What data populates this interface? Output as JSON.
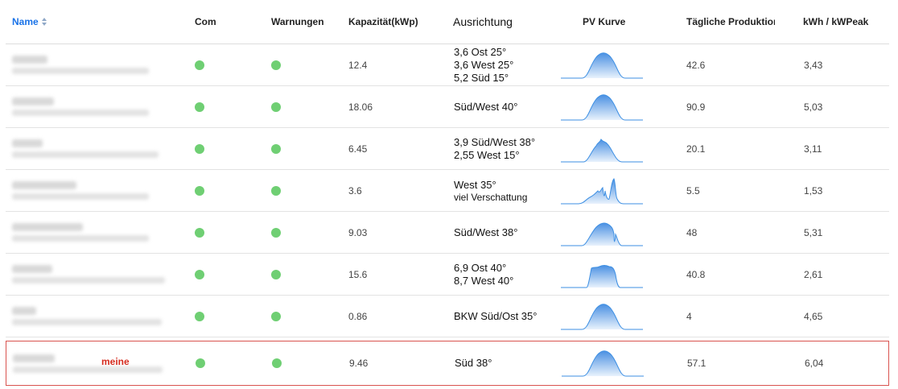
{
  "headers": {
    "name": "Name",
    "com": "Com",
    "warnungen": "Warnungen",
    "kapazitaet": "Kapazität(kWp)",
    "ausrichtung": "Ausrichtung",
    "pv_kurve": "PV Kurve",
    "taegliche": "Tägliche Produktion",
    "kwh_kwpeak": "kWh / kWPeak"
  },
  "colors": {
    "link": "#1a73e8",
    "status_ok": "#6fcf73",
    "highlight_border": "#d9534f",
    "meine_label": "#d62d20",
    "curve_stroke": "#3d8fe3"
  },
  "icons": {
    "sort": "sort-icon",
    "status": "status-dot"
  },
  "rows": [
    {
      "kapazitaet": "12.4",
      "ausrichtung": [
        "3,6 Ost 25°",
        "3,6 West 25°",
        "5,2 Süd 15°"
      ],
      "note": "",
      "produktion": "42.6",
      "kwh": "3,43",
      "curve": "single"
    },
    {
      "kapazitaet": "18.06",
      "ausrichtung": [
        "Süd/West 40°"
      ],
      "note": "",
      "produktion": "90.9",
      "kwh": "5,03",
      "curve": "single"
    },
    {
      "kapazitaet": "6.45",
      "ausrichtung": [
        "3,9 Süd/West 38°",
        "2,55 West 15°"
      ],
      "note": "",
      "produktion": "20.1",
      "kwh": "3,11",
      "curve": "bumpy"
    },
    {
      "kapazitaet": "3.6",
      "ausrichtung": [
        "West 35°"
      ],
      "note": "viel Verschattung",
      "produktion": "5.5",
      "kwh": "1,53",
      "curve": "shaded"
    },
    {
      "kapazitaet": "9.03",
      "ausrichtung": [
        "Süd/West 38°"
      ],
      "note": "",
      "produktion": "48",
      "kwh": "5,31",
      "curve": "dip"
    },
    {
      "kapazitaet": "15.6",
      "ausrichtung": [
        "6,9 Ost 40°",
        "8,7 West 40°"
      ],
      "note": "",
      "produktion": "40.8",
      "kwh": "2,61",
      "curve": "flat"
    },
    {
      "kapazitaet": "0.86",
      "ausrichtung": [
        "BKW Süd/Ost 35°"
      ],
      "note": "",
      "produktion": "4",
      "kwh": "4,65",
      "curve": "single"
    },
    {
      "kapazitaet": "9.46",
      "ausrichtung": [
        "Süd 38°"
      ],
      "note": "",
      "produktion": "57.1",
      "kwh": "6,04",
      "curve": "single",
      "label": "meine"
    }
  ]
}
